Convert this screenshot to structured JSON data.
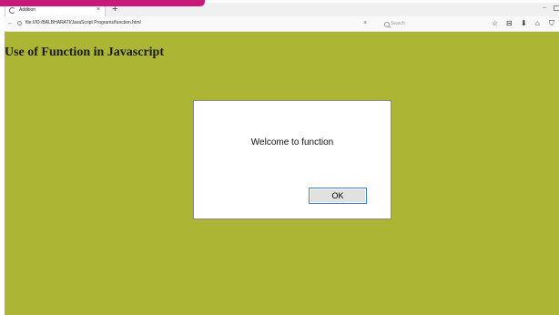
{
  "browser": {
    "tab_title": "Addition",
    "tab_close": "×",
    "new_tab": "+",
    "window_min": "–",
    "back": "←",
    "url": "file:///D:/BALBHARATI/JavaScript Programs/function.html",
    "clear_url": "×",
    "search_placeholder": "Search",
    "toolbar": {
      "bookmark": "☆",
      "library": "⊟",
      "download": "⬇",
      "home": "⌂",
      "shield": "⛉"
    }
  },
  "page": {
    "heading": "Use of Function in Javascript",
    "background_color": "#adb535"
  },
  "dialog": {
    "message": "Welcome to function",
    "ok_label": "OK",
    "focus_color": "#3c7fd4"
  },
  "colors": {
    "banner": "#c8187a"
  }
}
